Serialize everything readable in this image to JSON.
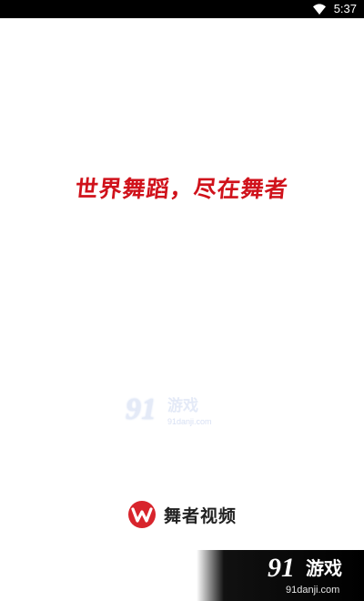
{
  "status_bar": {
    "time": "5:37",
    "icons": [
      "wifi-icon"
    ],
    "background": "#000000"
  },
  "splash": {
    "slogan": "世界舞蹈，尽在舞者",
    "slogan_color": "#d0121b"
  },
  "watermark": {
    "logo_number": "91",
    "title": "游戏",
    "url": "91danji.com"
  },
  "brand": {
    "logo_icon": "wuzhe-logo-icon",
    "name": "舞者视频",
    "logo_color": "#d8242c"
  },
  "corner_banner": {
    "logo_number": "91",
    "title": "游戏",
    "url": "91danji.com"
  }
}
